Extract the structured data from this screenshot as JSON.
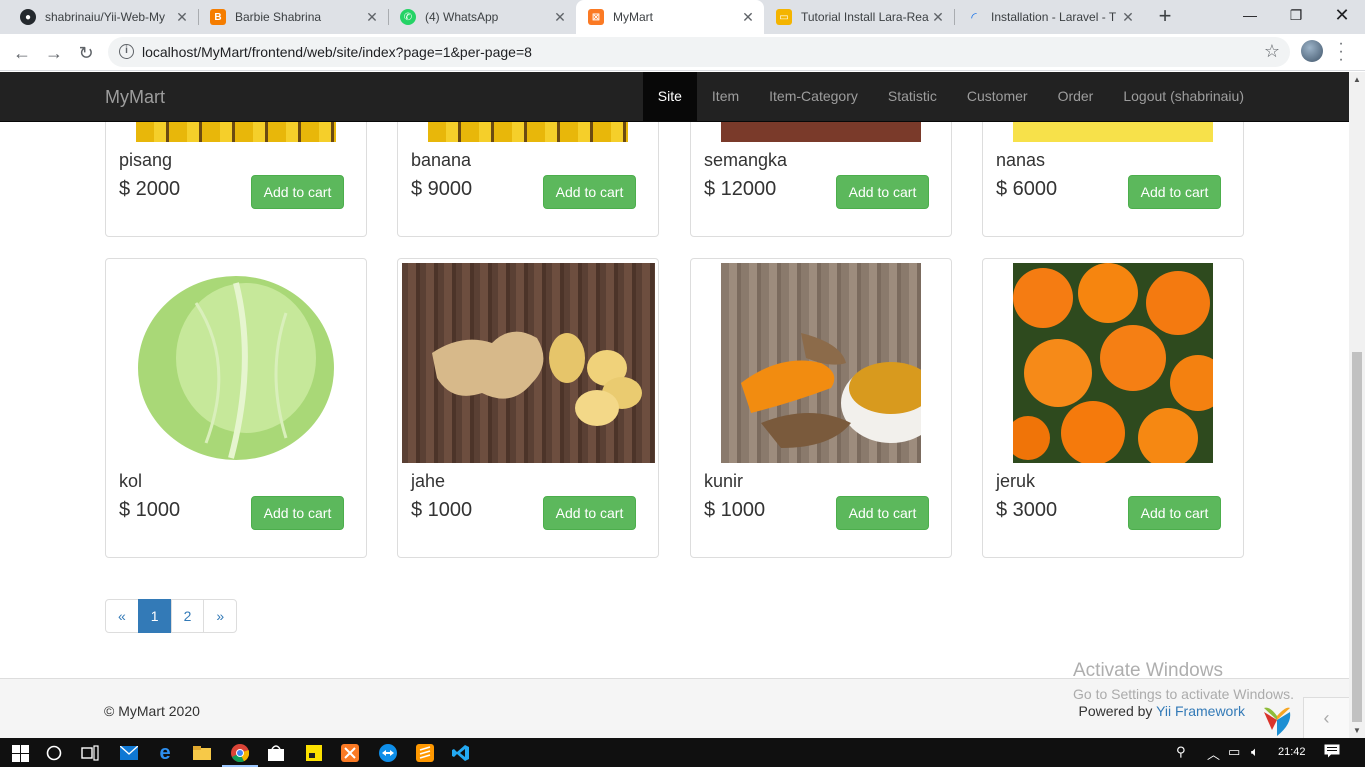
{
  "browser": {
    "tabs": [
      {
        "title": "shabrinaiu/Yii-Web-My",
        "icon": "github-icon",
        "color": "#24292e"
      },
      {
        "title": "Barbie Shabrina",
        "icon": "blogger-icon",
        "color": "#f57d00"
      },
      {
        "title": "(4) WhatsApp",
        "icon": "whatsapp-icon",
        "color": "#25d366"
      },
      {
        "title": "MyMart",
        "icon": "xampp-icon",
        "color": "#fb7a24",
        "active": true
      },
      {
        "title": "Tutorial Install Lara-Rea",
        "icon": "slides-icon",
        "color": "#f4b400"
      },
      {
        "title": "Installation - Laravel - T",
        "icon": "loading-icon",
        "color": "#1a73e8"
      }
    ],
    "new_tab": "+",
    "url": "localhost/MyMart/frontend/web/site/index?page=1&per-page=8"
  },
  "navbar": {
    "brand": "MyMart",
    "items": [
      "Site",
      "Item",
      "Item-Category",
      "Statistic",
      "Customer",
      "Order",
      "Logout (shabrinaiu)"
    ],
    "active": "Site"
  },
  "products": [
    {
      "name": "pisang",
      "price": "$ 2000",
      "button": "Add to cart"
    },
    {
      "name": "banana",
      "price": "$ 9000",
      "button": "Add to cart"
    },
    {
      "name": "semangka",
      "price": "$ 12000",
      "button": "Add to cart"
    },
    {
      "name": "nanas",
      "price": "$ 6000",
      "button": "Add to cart"
    },
    {
      "name": "kol",
      "price": "$ 1000",
      "button": "Add to cart"
    },
    {
      "name": "jahe",
      "price": "$ 1000",
      "button": "Add to cart"
    },
    {
      "name": "kunir",
      "price": "$ 1000",
      "button": "Add to cart"
    },
    {
      "name": "jeruk",
      "price": "$ 3000",
      "button": "Add to cart"
    }
  ],
  "pagination": {
    "prev": "«",
    "pages": [
      "1",
      "2"
    ],
    "active": "1",
    "next": "»"
  },
  "footer": {
    "copyright": "© MyMart 2020",
    "powered_prefix": "Powered by ",
    "powered_link": "Yii Framework"
  },
  "watermark": {
    "line1": "Activate Windows",
    "line2": "Go to Settings to activate Windows."
  },
  "taskbar": {
    "time": "21:42"
  },
  "colors": {
    "navbar_bg": "#222222",
    "button_green": "#5cb85c",
    "link_blue": "#337ab7"
  }
}
